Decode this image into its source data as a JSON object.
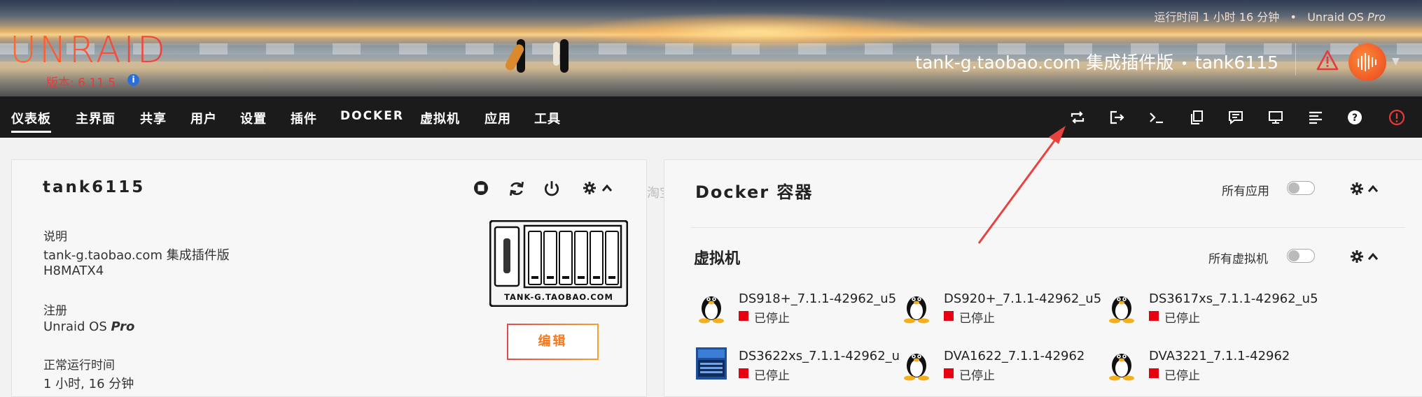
{
  "header": {
    "logo": "UNRAID",
    "version": "版本: 6.11.5",
    "uptime_text": "运行时间 1 小时 16 分钟",
    "separator": "•",
    "edition_prefix": "Unraid OS ",
    "edition": "Pro",
    "description": "tank-g.taobao.com 集成插件版",
    "server_name": "tank6115"
  },
  "nav": {
    "items": [
      "仪表板",
      "主界面",
      "共享",
      "用户",
      "设置",
      "插件",
      "DOCKER",
      "虚拟机",
      "应用",
      "工具"
    ],
    "icons": [
      "reboot-icon",
      "logout-icon",
      "terminal-icon",
      "feedback-icon",
      "notes-icon",
      "monitor-icon",
      "log-icon",
      "help-icon",
      "shutdown-icon"
    ]
  },
  "system": {
    "name": "tank6115",
    "desc_label": "说明",
    "desc_value": "tank-g.taobao.com 集成插件版",
    "model": "H8MATX4",
    "reg_label": "注册",
    "reg_value_prefix": "Unraid OS ",
    "reg_value_edition": "Pro",
    "uptime_label": "正常运行时间",
    "uptime_value": "1 小时, 16 分钟",
    "edit_label": "编辑",
    "nas_caption": "TANK-G.TAOBAO.COM"
  },
  "watermark": "淘宝店：tank电玩",
  "docker": {
    "title": "Docker 容器",
    "toggle_label": "所有应用"
  },
  "vms": {
    "title": "虚拟机",
    "toggle_label": "所有虚拟机",
    "items": [
      {
        "name": "DS918+_7.1.1-42962_u5",
        "status": "已停止",
        "icon": "linux-tux-icon"
      },
      {
        "name": "DS920+_7.1.1-42962_u5",
        "status": "已停止",
        "icon": "linux-tux-icon"
      },
      {
        "name": "DS3617xs_7.1.1-42962_u5",
        "status": "已停止",
        "icon": "linux-tux-icon"
      },
      {
        "name": "DS3622xs_7.1.1-42962_u",
        "status": "已停止",
        "icon": "synology-nas-icon"
      },
      {
        "name": "DVA1622_7.1.1-42962",
        "status": "已停止",
        "icon": "linux-tux-icon"
      },
      {
        "name": "DVA3221_7.1.1-42962",
        "status": "已停止",
        "icon": "linux-tux-icon"
      }
    ]
  },
  "colors": {
    "accent": "#ff5a36",
    "navbar": "#1c1b1b",
    "stopped": "#e60012",
    "edit_button": "#f07b22",
    "annotation_arrow": "#e8423f"
  }
}
